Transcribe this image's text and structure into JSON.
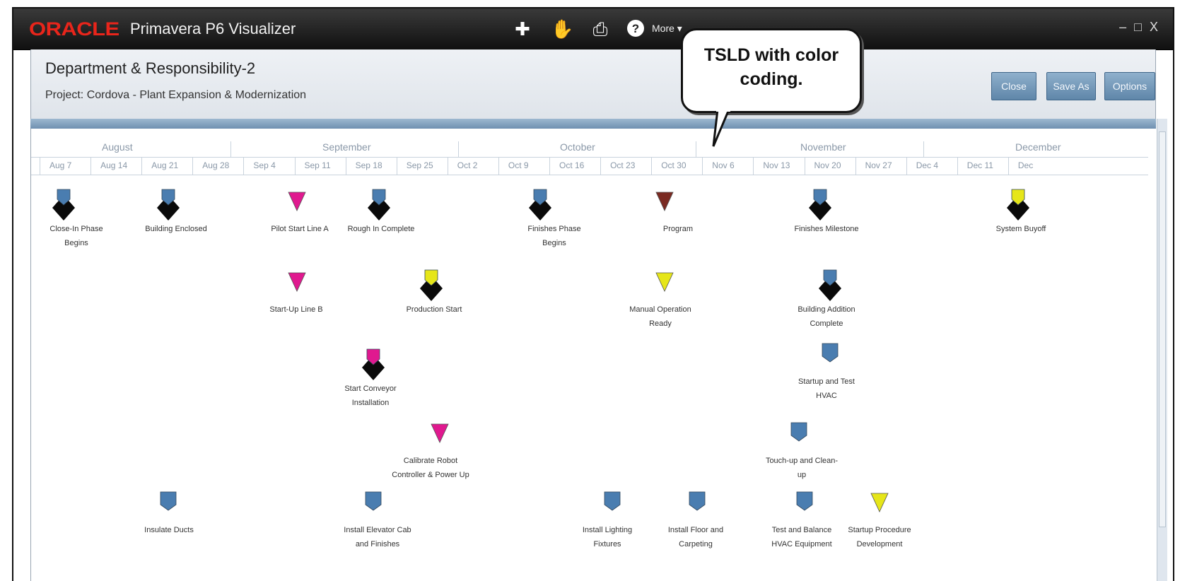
{
  "window": {
    "brand": "ORACLE",
    "title": "Primavera P6 Visualizer",
    "more_label": "More",
    "controls": "– □ X"
  },
  "toolbar_icons": [
    "add-icon",
    "pan-hand-icon",
    "print-icon",
    "help-icon"
  ],
  "header": {
    "layout_name": "Department & Responsibility-2",
    "project": "Project: Cordova - Plant Expansion & Modernization",
    "buttons": {
      "close": "Close",
      "save_as": "Save As",
      "options": "Options"
    }
  },
  "callout": {
    "text": "TSLD with color coding."
  },
  "timescale": {
    "months": [
      "August",
      "September",
      "October",
      "November",
      "December"
    ],
    "weeks": [
      "Aug 7",
      "Aug 14",
      "Aug 21",
      "Aug 28",
      "Sep 4",
      "Sep 11",
      "Sep 18",
      "Sep 25",
      "Oct 2",
      "Oct 9",
      "Oct 16",
      "Oct 23",
      "Oct 30",
      "Nov 6",
      "Nov 13",
      "Nov 20",
      "Nov 27",
      "Dec 4",
      "Dec 11",
      "Dec"
    ]
  },
  "colors": {
    "blue": "#4a7db0",
    "magenta": "#e0198f",
    "yellow": "#e6e619",
    "maroon": "#7a2a22",
    "black": "#0a0a0a"
  },
  "milestones": [
    {
      "label": "Close-In Phase Begins",
      "kind": "blue-diamond"
    },
    {
      "label": "Building Enclosed",
      "kind": "blue-diamond"
    },
    {
      "label": "Pilot Start Line A",
      "kind": "magenta-triangle"
    },
    {
      "label": "Rough In Complete",
      "kind": "blue-diamond"
    },
    {
      "label": "Finishes Phase Begins",
      "kind": "blue-diamond"
    },
    {
      "label": "Program",
      "kind": "maroon-triangle"
    },
    {
      "label": "Finishes Milestone",
      "kind": "blue-diamond"
    },
    {
      "label": "System Buyoff",
      "kind": "yellow-diamond"
    },
    {
      "label": "Start-Up Line B",
      "kind": "magenta-triangle"
    },
    {
      "label": "Production Start",
      "kind": "yellow-diamond"
    },
    {
      "label": "Manual Operation Ready",
      "kind": "yellow-triangle"
    },
    {
      "label": "Building Addition Complete",
      "kind": "blue-diamond"
    },
    {
      "label": "Start Conveyor Installation",
      "kind": "magenta-diamond"
    },
    {
      "label": "Startup and Test HVAC",
      "kind": "blue-pentagon"
    },
    {
      "label": "Calibrate Robot Controller & Power Up",
      "kind": "magenta-triangle"
    },
    {
      "label": "Touch-up and Clean-up",
      "kind": "blue-pentagon"
    },
    {
      "label": "Insulate Ducts",
      "kind": "blue-pentagon"
    },
    {
      "label": "Install Elevator Cab and Finishes",
      "kind": "blue-pentagon"
    },
    {
      "label": "Install Lighting Fixtures",
      "kind": "blue-pentagon"
    },
    {
      "label": "Install Floor and Carpeting",
      "kind": "blue-pentagon"
    },
    {
      "label": "Test and Balance HVAC Equipment",
      "kind": "blue-pentagon"
    },
    {
      "label": "Startup Procedure Development",
      "kind": "yellow-triangle"
    }
  ]
}
